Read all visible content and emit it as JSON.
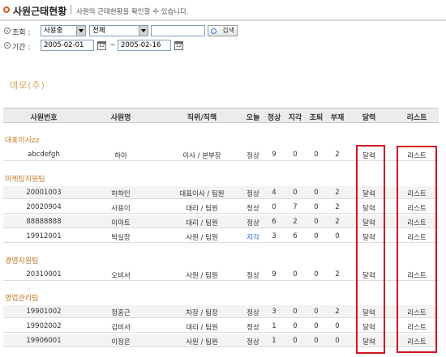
{
  "header": {
    "title": "사원근태현황",
    "description": "사원의 근태현황을 확인할 수 있습니다."
  },
  "filters": {
    "search_label": "조회 :",
    "status_select": "사용중",
    "scope_select": "전체",
    "keyword_value": "",
    "search_button": "검색",
    "period_label": "기간 :",
    "start_date": "2005-02-01",
    "tilde": "~",
    "end_date": "2005-02-16",
    "calendar_icon_text": "12"
  },
  "company": "데모(주)",
  "columns": [
    "사원번호",
    "사원명",
    "직위/직책",
    "오늘",
    "정상",
    "지각",
    "조퇴",
    "부재",
    "달력",
    "리스트"
  ],
  "groups": [
    {
      "name": "대표이사zz",
      "rows": [
        {
          "id": "abcdefgh",
          "name": "하아",
          "position": "이사 / 본부장",
          "today": "정상",
          "normal": "9",
          "late": "0",
          "early": "0",
          "absent": "2",
          "calendar": "달력",
          "list": "리스트"
        }
      ]
    },
    {
      "name": "마케팅지원팀",
      "rows": [
        {
          "id": "20001003",
          "name": "하하인",
          "position": "대표이사 / 팀원",
          "today": "정상",
          "normal": "4",
          "late": "0",
          "early": "0",
          "absent": "2",
          "calendar": "달력",
          "list": "리스트"
        },
        {
          "id": "20020904",
          "name": "사용이",
          "position": "대리 / 팀원",
          "today": "정상",
          "normal": "0",
          "late": "7",
          "early": "0",
          "absent": "2",
          "calendar": "달력",
          "list": "리스트"
        },
        {
          "id": "88888888",
          "name": "이마트",
          "position": "대리 / 팀원",
          "today": "정상",
          "normal": "6",
          "late": "2",
          "early": "0",
          "absent": "2",
          "calendar": "달력",
          "list": "리스트"
        },
        {
          "id": "19912001",
          "name": "박실장",
          "position": "사원 / 팀원",
          "today": "지각",
          "normal": "3",
          "late": "6",
          "early": "0",
          "absent": "0",
          "calendar": "달력",
          "list": "리스트"
        }
      ]
    },
    {
      "name": "경영지원팀",
      "rows": [
        {
          "id": "20310001",
          "name": "오비서",
          "position": "사원 / 팀원",
          "today": "정상",
          "normal": "9",
          "late": "0",
          "early": "0",
          "absent": "2",
          "calendar": "달력",
          "list": "리스트"
        }
      ]
    },
    {
      "name": "영업관리팀",
      "rows": [
        {
          "id": "19901002",
          "name": "정홍근",
          "position": "차장 / 팀장",
          "today": "정상",
          "normal": "3",
          "late": "0",
          "early": "0",
          "absent": "2",
          "calendar": "달력",
          "list": "리스트"
        },
        {
          "id": "19902002",
          "name": "김비서",
          "position": "대리 / 팀원",
          "today": "정상",
          "normal": "1",
          "late": "0",
          "early": "0",
          "absent": "0",
          "calendar": "달력",
          "list": "리스트"
        },
        {
          "id": "19906001",
          "name": "이정은",
          "position": "사원 / 팀원",
          "today": "정상",
          "normal": "1",
          "late": "0",
          "early": "0",
          "absent": "0",
          "calendar": "달력",
          "list": "리스트"
        }
      ]
    }
  ],
  "colors": {
    "accent": "#e25a1c",
    "group_label": "#c0792b",
    "company": "#d9a05a",
    "late_text": "#2a5fd1",
    "highlight": "#d2161e"
  }
}
